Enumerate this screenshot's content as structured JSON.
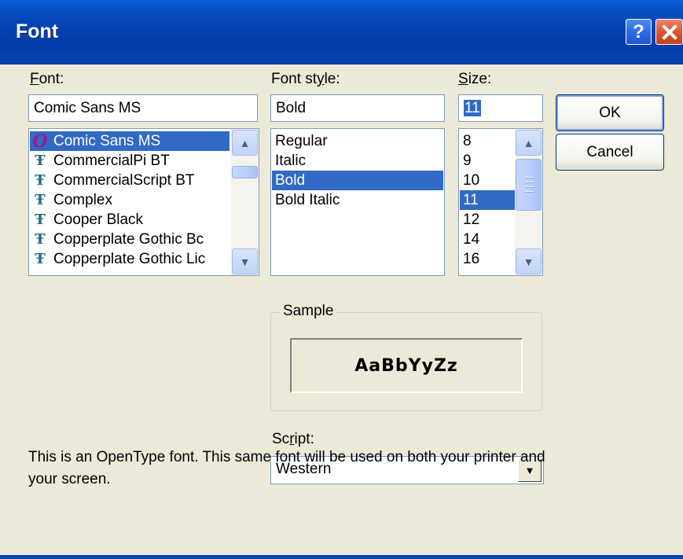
{
  "window": {
    "title": "Font",
    "help_glyph": "?",
    "close_glyph": "✕"
  },
  "font": {
    "label_key": "F",
    "label_rest": "ont:",
    "value": "Comic Sans MS",
    "items": [
      {
        "name": "Comic Sans MS",
        "icon": "opentype-icon",
        "glyph": "O",
        "selected": true
      },
      {
        "name": "CommercialPi BT",
        "icon": "truetype-icon",
        "glyph": "Ŧ",
        "selected": false
      },
      {
        "name": "CommercialScript BT",
        "icon": "truetype-icon",
        "glyph": "Ŧ",
        "selected": false
      },
      {
        "name": "Complex",
        "icon": "truetype-icon",
        "glyph": "Ŧ",
        "selected": false
      },
      {
        "name": "Cooper Black",
        "icon": "truetype-icon",
        "glyph": "Ŧ",
        "selected": false
      },
      {
        "name": "Copperplate Gothic Bc",
        "icon": "truetype-icon",
        "glyph": "Ŧ",
        "selected": false
      },
      {
        "name": "Copperplate Gothic Lic",
        "icon": "truetype-icon",
        "glyph": "Ŧ",
        "selected": false
      }
    ]
  },
  "style": {
    "label_key": "y",
    "label_pre": "Font st",
    "label_post": "le:",
    "value": "Bold",
    "items": [
      "Regular",
      "Italic",
      "Bold",
      "Bold Italic"
    ],
    "selected": "Bold"
  },
  "size": {
    "label_key": "S",
    "label_rest": "ize:",
    "value": "11",
    "items": [
      "8",
      "9",
      "10",
      "11",
      "12",
      "14",
      "16"
    ],
    "selected": "11"
  },
  "buttons": {
    "ok": "OK",
    "cancel": "Cancel"
  },
  "sample": {
    "legend": "Sample",
    "text": "AaBbYyZz"
  },
  "script": {
    "label_pre": "Sc",
    "label_key": "r",
    "label_post": "ipt:",
    "value": "Western"
  },
  "description": "This is an OpenType font. This same font will be used on both your printer and your screen.",
  "colors": {
    "titlebar": "#0442b2",
    "selection": "#316ac5",
    "dialog_bg": "#ece9d8",
    "close_button": "#d9512d"
  }
}
